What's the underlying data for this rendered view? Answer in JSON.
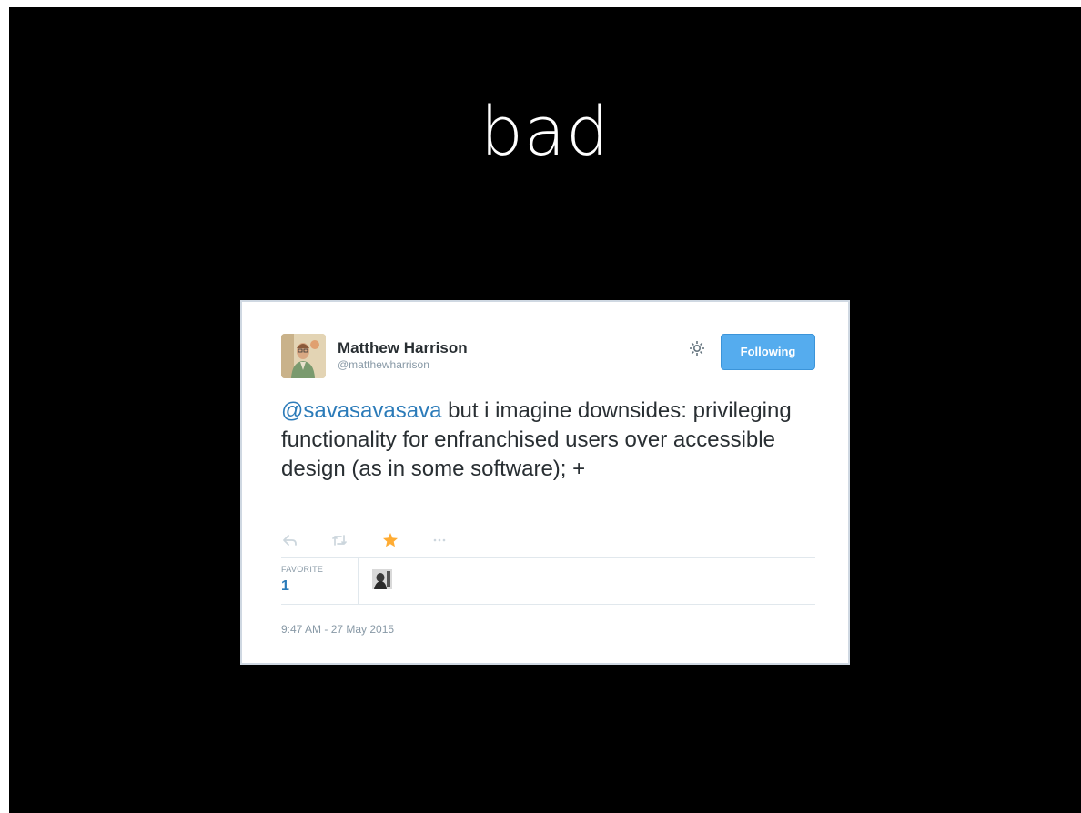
{
  "slide": {
    "title": "bad",
    "background_color": "#000000"
  },
  "tweet": {
    "user": {
      "name": "Matthew Harrison",
      "handle": "@matthewharrison",
      "avatar_icon": "user-avatar-illustration"
    },
    "follow_button_label": "Following",
    "settings_icon": "gear-icon",
    "text": {
      "mention": "@savasavasava",
      "body": " but i imagine downsides: privileging functionality for enfranchised users over accessible design (as in some software); +"
    },
    "actions": [
      {
        "name": "reply-icon",
        "state": "default"
      },
      {
        "name": "retweet-icon",
        "state": "default"
      },
      {
        "name": "favorite-star-icon",
        "state": "active",
        "color": "#ffac33"
      },
      {
        "name": "more-icon",
        "state": "default"
      }
    ],
    "stats": {
      "favorite_label": "FAVORITE",
      "favorite_count": "1"
    },
    "timestamp": "9:47 AM - 27 May 2015",
    "colors": {
      "link": "#2b7bb9",
      "button": "#55acee",
      "muted": "#8899a6",
      "text": "#292f33"
    }
  }
}
